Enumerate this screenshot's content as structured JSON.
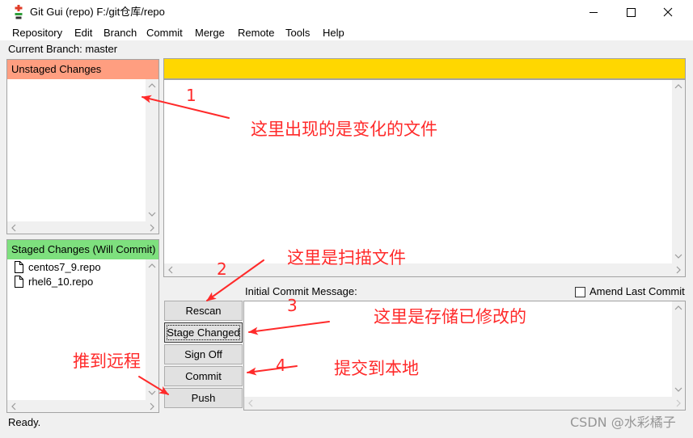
{
  "window": {
    "title": "Git Gui (repo) F:/git仓库/repo",
    "icon": "git-gui-icon",
    "controls": [
      "minimize-icon",
      "maximize-icon",
      "close-icon"
    ]
  },
  "menu": [
    {
      "label": "Repository"
    },
    {
      "label": "Edit"
    },
    {
      "label": "Branch"
    },
    {
      "label": "Commit"
    },
    {
      "label": "Merge"
    },
    {
      "label": "Remote"
    },
    {
      "label": "Tools"
    },
    {
      "label": "Help"
    }
  ],
  "branch": {
    "text": "Current Branch: master"
  },
  "unstaged": {
    "header": "Unstaged Changes",
    "files": []
  },
  "staged": {
    "header": "Staged Changes (Will Commit)",
    "files": [
      {
        "name": "centos7_9.repo",
        "icon": "file-icon"
      },
      {
        "name": "rhel6_10.repo",
        "icon": "file-icon"
      }
    ]
  },
  "commit": {
    "label": "Initial Commit Message:",
    "amend_label": "Amend Last Commit",
    "amend_checked": false,
    "message": ""
  },
  "buttons": {
    "rescan": "Rescan",
    "stage_changed": "Stage Changed",
    "sign_off": "Sign Off",
    "commit": "Commit",
    "push": "Push"
  },
  "status": {
    "text": "Ready."
  },
  "watermark": "CSDN @水彩橘子",
  "annotations": [
    {
      "number": "1",
      "text": "这里出现的是变化的文件"
    },
    {
      "number": "2",
      "text": "这里是扫描文件"
    },
    {
      "number": "3",
      "text": "这里是存储已修改的"
    },
    {
      "number": "4",
      "text": "提交到本地"
    },
    {
      "text": "推到远程"
    }
  ],
  "colors": {
    "unstaged_header": "#FF9E80",
    "staged_header": "#7EE07E",
    "diff_header": "#FFD700",
    "annotation": "#FF2A2A"
  }
}
